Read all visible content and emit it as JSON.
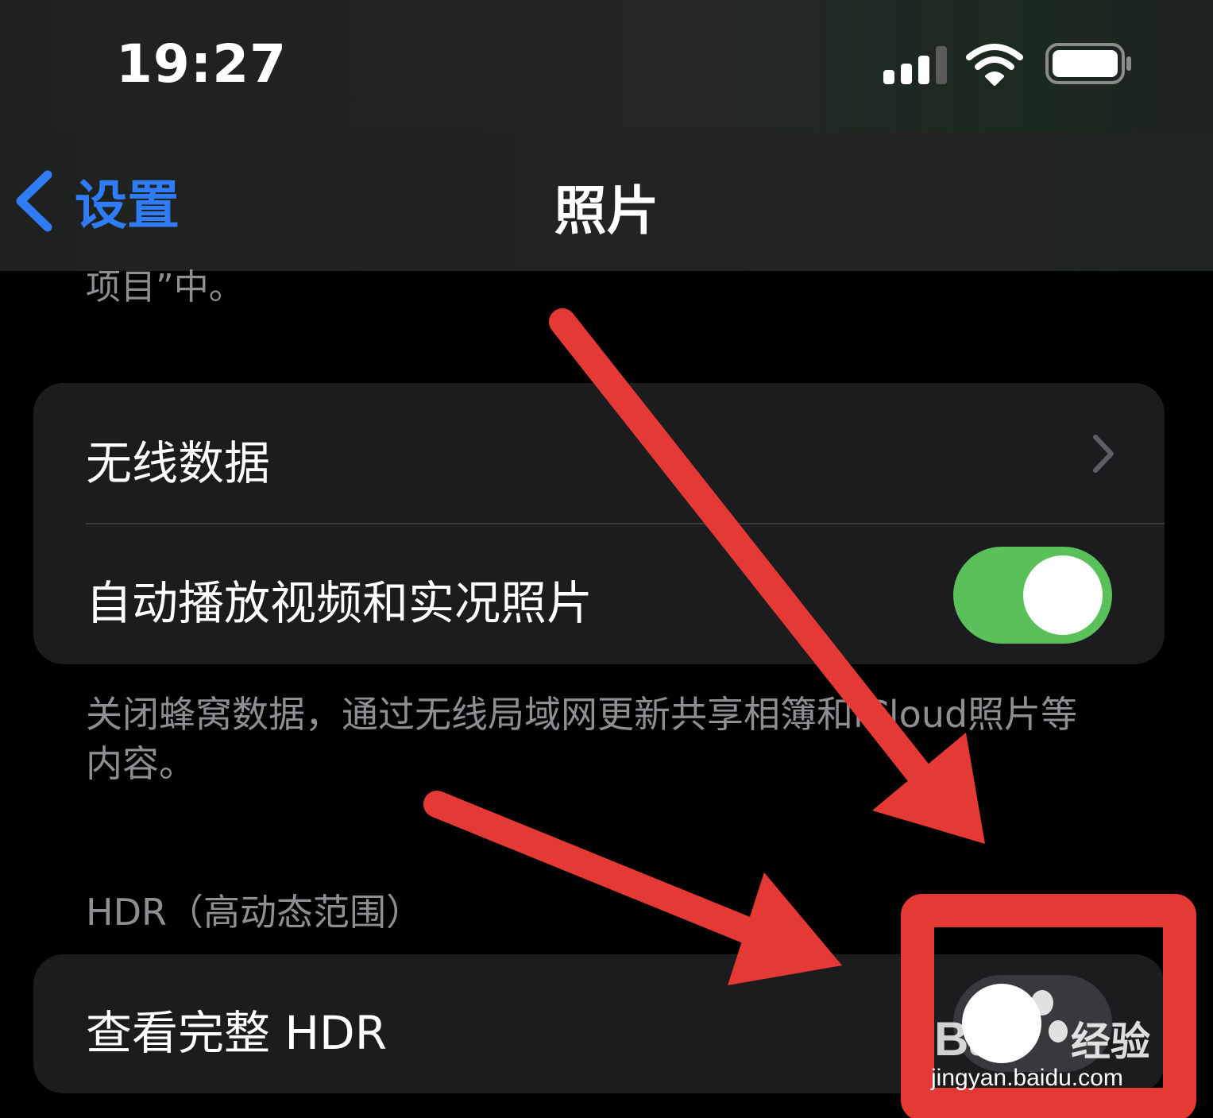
{
  "status_bar": {
    "time": "19:27",
    "icons": [
      "signal-icon",
      "wifi-icon",
      "battery-icon"
    ]
  },
  "nav": {
    "back_label": "设置",
    "title": "照片"
  },
  "top_clipped_text": "项目”中。",
  "cellular_group": {
    "rows": [
      {
        "label": "无线数据",
        "accessory": "chevron"
      },
      {
        "label": "自动播放视频和实况照片",
        "accessory": "toggle",
        "on": true
      }
    ],
    "footer": "关闭蜂窝数据，通过无线局域网更新共享相簿和iCloud照片等内容。"
  },
  "hdr_group": {
    "header": "HDR（高动态范围）",
    "rows": [
      {
        "label": "查看完整 HDR",
        "accessory": "toggle",
        "on": false
      }
    ]
  },
  "annotation": {
    "arrow_color": "#e53935",
    "box_color": "#e53935"
  },
  "watermark": {
    "brand": "Baidu经验",
    "url": "jingyan.baidu.com"
  },
  "colors": {
    "accent_blue": "#2f7cf6",
    "toggle_on_green": "#5ac15a",
    "secondary_text": "#8e8e93",
    "cell_background": "#1c1c1e"
  }
}
